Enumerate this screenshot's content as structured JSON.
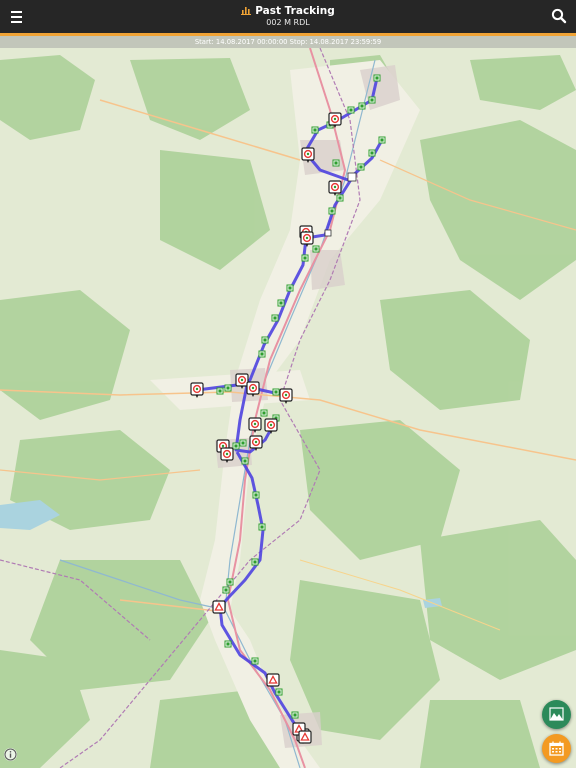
{
  "header": {
    "title": "Past Tracking",
    "subtitle": "002 M RDL",
    "menu_icon": "hamburger-menu-icon",
    "search_icon": "search-icon",
    "title_icon": "bar-chart-icon"
  },
  "time_range": {
    "text": "Start: 14.08.2017 00:00:00 Stop: 14.08.2017 23:59:59"
  },
  "map": {
    "route_color": "#4a3fe0",
    "marker_colors": {
      "stop": "#e53935",
      "point": "#2e9e2e",
      "warning": "#e53935"
    }
  },
  "controls": {
    "info_icon": "info-icon",
    "map_layers_icon": "map-layers-icon",
    "calendar_icon": "calendar-icon"
  },
  "colors": {
    "header_bg": "#262626",
    "accent": "#f0a335",
    "fab_green": "#2c8a5a",
    "fab_orange": "#f39a22"
  }
}
